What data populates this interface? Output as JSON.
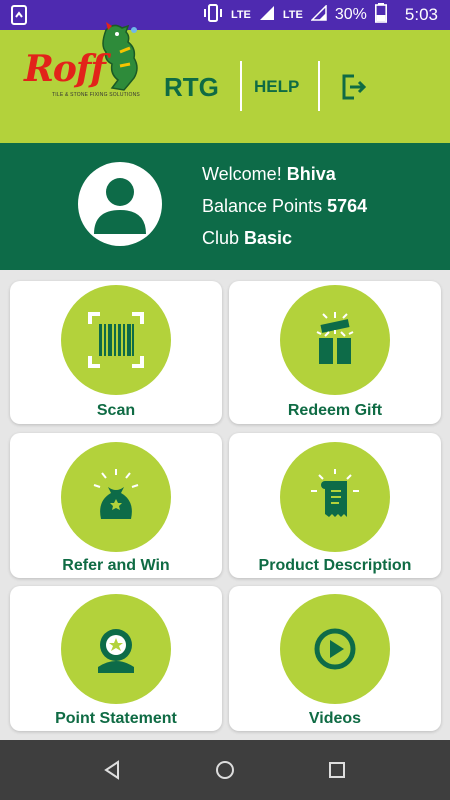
{
  "status_bar": {
    "network_1": "LTE",
    "network_2": "LTE",
    "battery": "30%",
    "time": "5:03"
  },
  "header": {
    "brand_logo": "Roff",
    "brand_tagline": "TILE & STONE FIXING SOLUTIONS",
    "title": "RTG",
    "help_label": "HELP",
    "logout_icon": "logout-icon"
  },
  "profile": {
    "welcome_prefix": "Welcome! ",
    "name": "Bhiva",
    "balance_prefix": "Balance Points ",
    "balance": "5764",
    "club_prefix": "Club ",
    "club": "Basic"
  },
  "menu": [
    {
      "label": "Scan",
      "icon": "barcode-icon"
    },
    {
      "label": "Redeem Gift",
      "icon": "gift-icon"
    },
    {
      "label": "Refer and Win",
      "icon": "money-bag-icon"
    },
    {
      "label": "Product Description",
      "icon": "receipt-icon"
    },
    {
      "label": "Point Statement",
      "icon": "star-badge-icon"
    },
    {
      "label": "Videos",
      "icon": "play-icon"
    }
  ],
  "colors": {
    "status_bar": "#4e2ab0",
    "accent_green": "#b3d23b",
    "dark_green": "#0d6b48",
    "nav_bar": "#3e3e3e"
  }
}
